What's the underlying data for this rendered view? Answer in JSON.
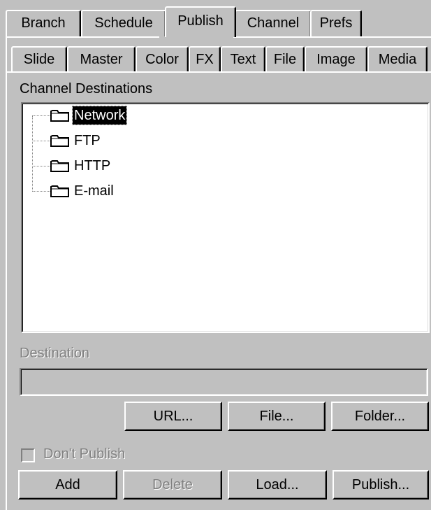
{
  "main_tabs": [
    {
      "label": "Branch",
      "active": false
    },
    {
      "label": "Schedule",
      "active": false
    },
    {
      "label": "Publish",
      "active": true
    },
    {
      "label": "Channel",
      "active": false
    },
    {
      "label": "Prefs",
      "active": false
    }
  ],
  "sub_tabs": [
    {
      "label": "Slide"
    },
    {
      "label": "Master"
    },
    {
      "label": "Color"
    },
    {
      "label": "FX"
    },
    {
      "label": "Text"
    },
    {
      "label": "File"
    },
    {
      "label": "Image"
    },
    {
      "label": "Media"
    }
  ],
  "destinations": {
    "heading": "Channel Destinations",
    "items": [
      {
        "label": "Network",
        "selected": true,
        "icon": "folder-icon"
      },
      {
        "label": "FTP",
        "selected": false,
        "icon": "folder-icon"
      },
      {
        "label": "HTTP",
        "selected": false,
        "icon": "folder-icon"
      },
      {
        "label": "E-mail",
        "selected": false,
        "icon": "folder-icon"
      }
    ]
  },
  "destination_field": {
    "label": "Destination",
    "value": ""
  },
  "picker_buttons": {
    "url": "URL...",
    "file": "File...",
    "folder": "Folder..."
  },
  "dont_publish": {
    "label": "Don't Publish",
    "checked": false
  },
  "actions": {
    "add": "Add",
    "delete": "Delete",
    "load": "Load...",
    "publish": "Publish..."
  },
  "colors": {
    "face": "#c0c0c0",
    "selection": "#000000",
    "disabled_text": "#808080"
  }
}
